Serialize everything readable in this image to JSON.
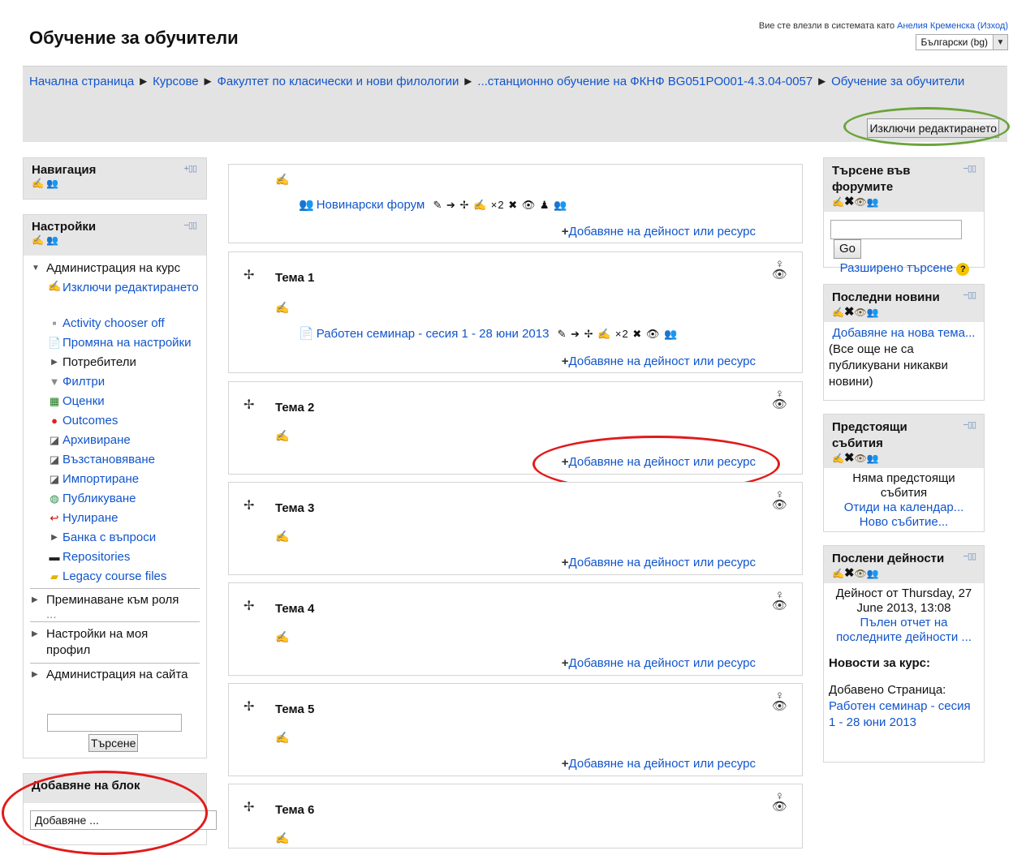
{
  "header": {
    "site_title": "Обучение за обучители",
    "login_prefix": "Вие сте влезли в системата като",
    "user_name": "Анелия Кременска",
    "logout": "(Изход)",
    "language": "Български (bg)"
  },
  "breadcrumb": {
    "items": [
      "Начална страница",
      "Курсове",
      "Факултет по класически и нови филологии",
      "...станционно обучение на ФКНФ BG051PO001-4.3.04-0057",
      "Обучение за обучители"
    ],
    "separator": "►"
  },
  "edit_button": "Изключи редактирането",
  "navigation_block": {
    "title": "Навигация"
  },
  "settings_block": {
    "title": "Настройки",
    "course_admin": "Администрация на курс",
    "items": [
      {
        "label": "Изключи редактирането",
        "icon": "pencil-icon"
      },
      {
        "label": "Activity chooser off",
        "icon": "bullet-icon"
      },
      {
        "label": "Промяна на настройки",
        "icon": "settings-doc-icon"
      },
      {
        "label": "Потребители",
        "icon": "expand-icon"
      },
      {
        "label": "Филтри",
        "icon": "filter-icon"
      },
      {
        "label": "Оценки",
        "icon": "grades-icon"
      },
      {
        "label": "Outcomes",
        "icon": "outcomes-icon"
      },
      {
        "label": "Архивиране",
        "icon": "backup-icon"
      },
      {
        "label": "Възстановяване",
        "icon": "restore-icon"
      },
      {
        "label": "Импортиране",
        "icon": "import-icon"
      },
      {
        "label": "Публикуване",
        "icon": "publish-icon"
      },
      {
        "label": "Нулиране",
        "icon": "reset-icon"
      },
      {
        "label": "Банка с въпроси",
        "icon": "expand-icon"
      },
      {
        "label": "Repositories",
        "icon": "repository-icon"
      },
      {
        "label": "Legacy course files",
        "icon": "folder-icon"
      }
    ],
    "switch_role": "Преминаване към роля",
    "switch_role_more": "...",
    "my_profile": "Настройки на моя профил",
    "site_admin": "Администрация на сайта",
    "search_button": "Търсене"
  },
  "add_block": {
    "title": "Добавяне на блок",
    "placeholder": "Добавяне ..."
  },
  "sections": {
    "add_label": "Добавяне на дейност или ресурс",
    "general_activity": "Новинарски форум",
    "topics": [
      {
        "name": "Тема 1",
        "activity": "Работен семинар - сесия 1 - 28 юни 2013"
      },
      {
        "name": "Тема 2"
      },
      {
        "name": "Тема 3"
      },
      {
        "name": "Тема 4"
      },
      {
        "name": "Тема 5"
      },
      {
        "name": "Тема 6"
      }
    ]
  },
  "forum_search": {
    "title": "Търсене във форумите",
    "go": "Go",
    "advanced": "Разширено търсене"
  },
  "latest_news": {
    "title": "Последни новини",
    "add_topic": "Добавяне на нова тема...",
    "empty": "(Все още не са публикувани никакви новини)"
  },
  "upcoming_events": {
    "title": "Предстоящи събития",
    "none": "Няма предстоящи събития",
    "calendar": "Отиди на календар...",
    "new_event": "Ново събитие..."
  },
  "recent_activity": {
    "title": "Послени дейности",
    "since": "Дейност от Thursday, 27 June 2013, 13:08",
    "full_report": "Пълен отчет на последните дейности ...",
    "course_news_title": "Новости за курс:",
    "added_page": "Добавено Страница:",
    "page_link": "Работен семинар - сесия 1 - 28 юни 2013"
  },
  "colors": {
    "link": "#1155cc",
    "header_bg": "#e3e3e3",
    "annotation_red": "#e01b1b",
    "annotation_green": "#6aa43a"
  }
}
